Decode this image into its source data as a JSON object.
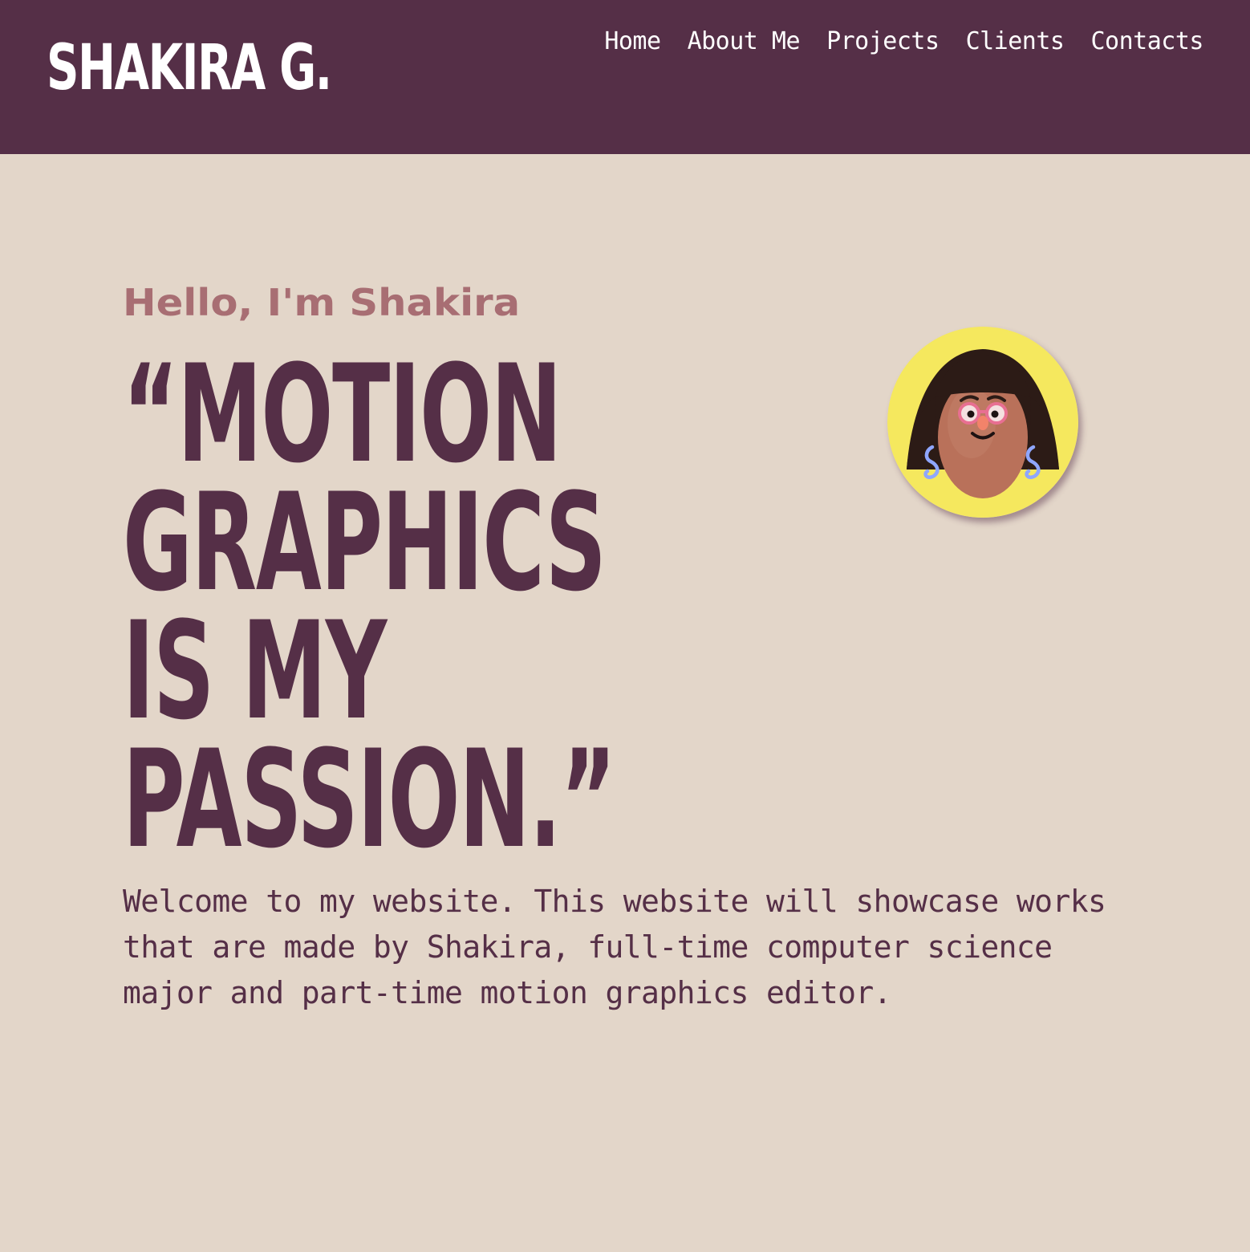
{
  "header": {
    "logo": "SHAKIRA G.",
    "nav": [
      {
        "label": "Home"
      },
      {
        "label": "About Me"
      },
      {
        "label": "Projects"
      },
      {
        "label": "Clients"
      },
      {
        "label": "Contacts"
      }
    ]
  },
  "hero": {
    "greeting": "Hello, I'm Shakira",
    "quote_lines": [
      "“MOTION",
      "GRAPHICS",
      "IS MY",
      "PASSION.”"
    ],
    "intro": "Welcome to my website. This website will showcase works that are made by Shakira, full-time computer science major and part-time motion graphics editor.",
    "avatar_icon": "avatar-illustration-icon"
  },
  "colors": {
    "header_bg": "#552f47",
    "page_bg": "#e3d6c9",
    "greeting": "#a86e73",
    "avatar_bg": "#f5e85e"
  }
}
